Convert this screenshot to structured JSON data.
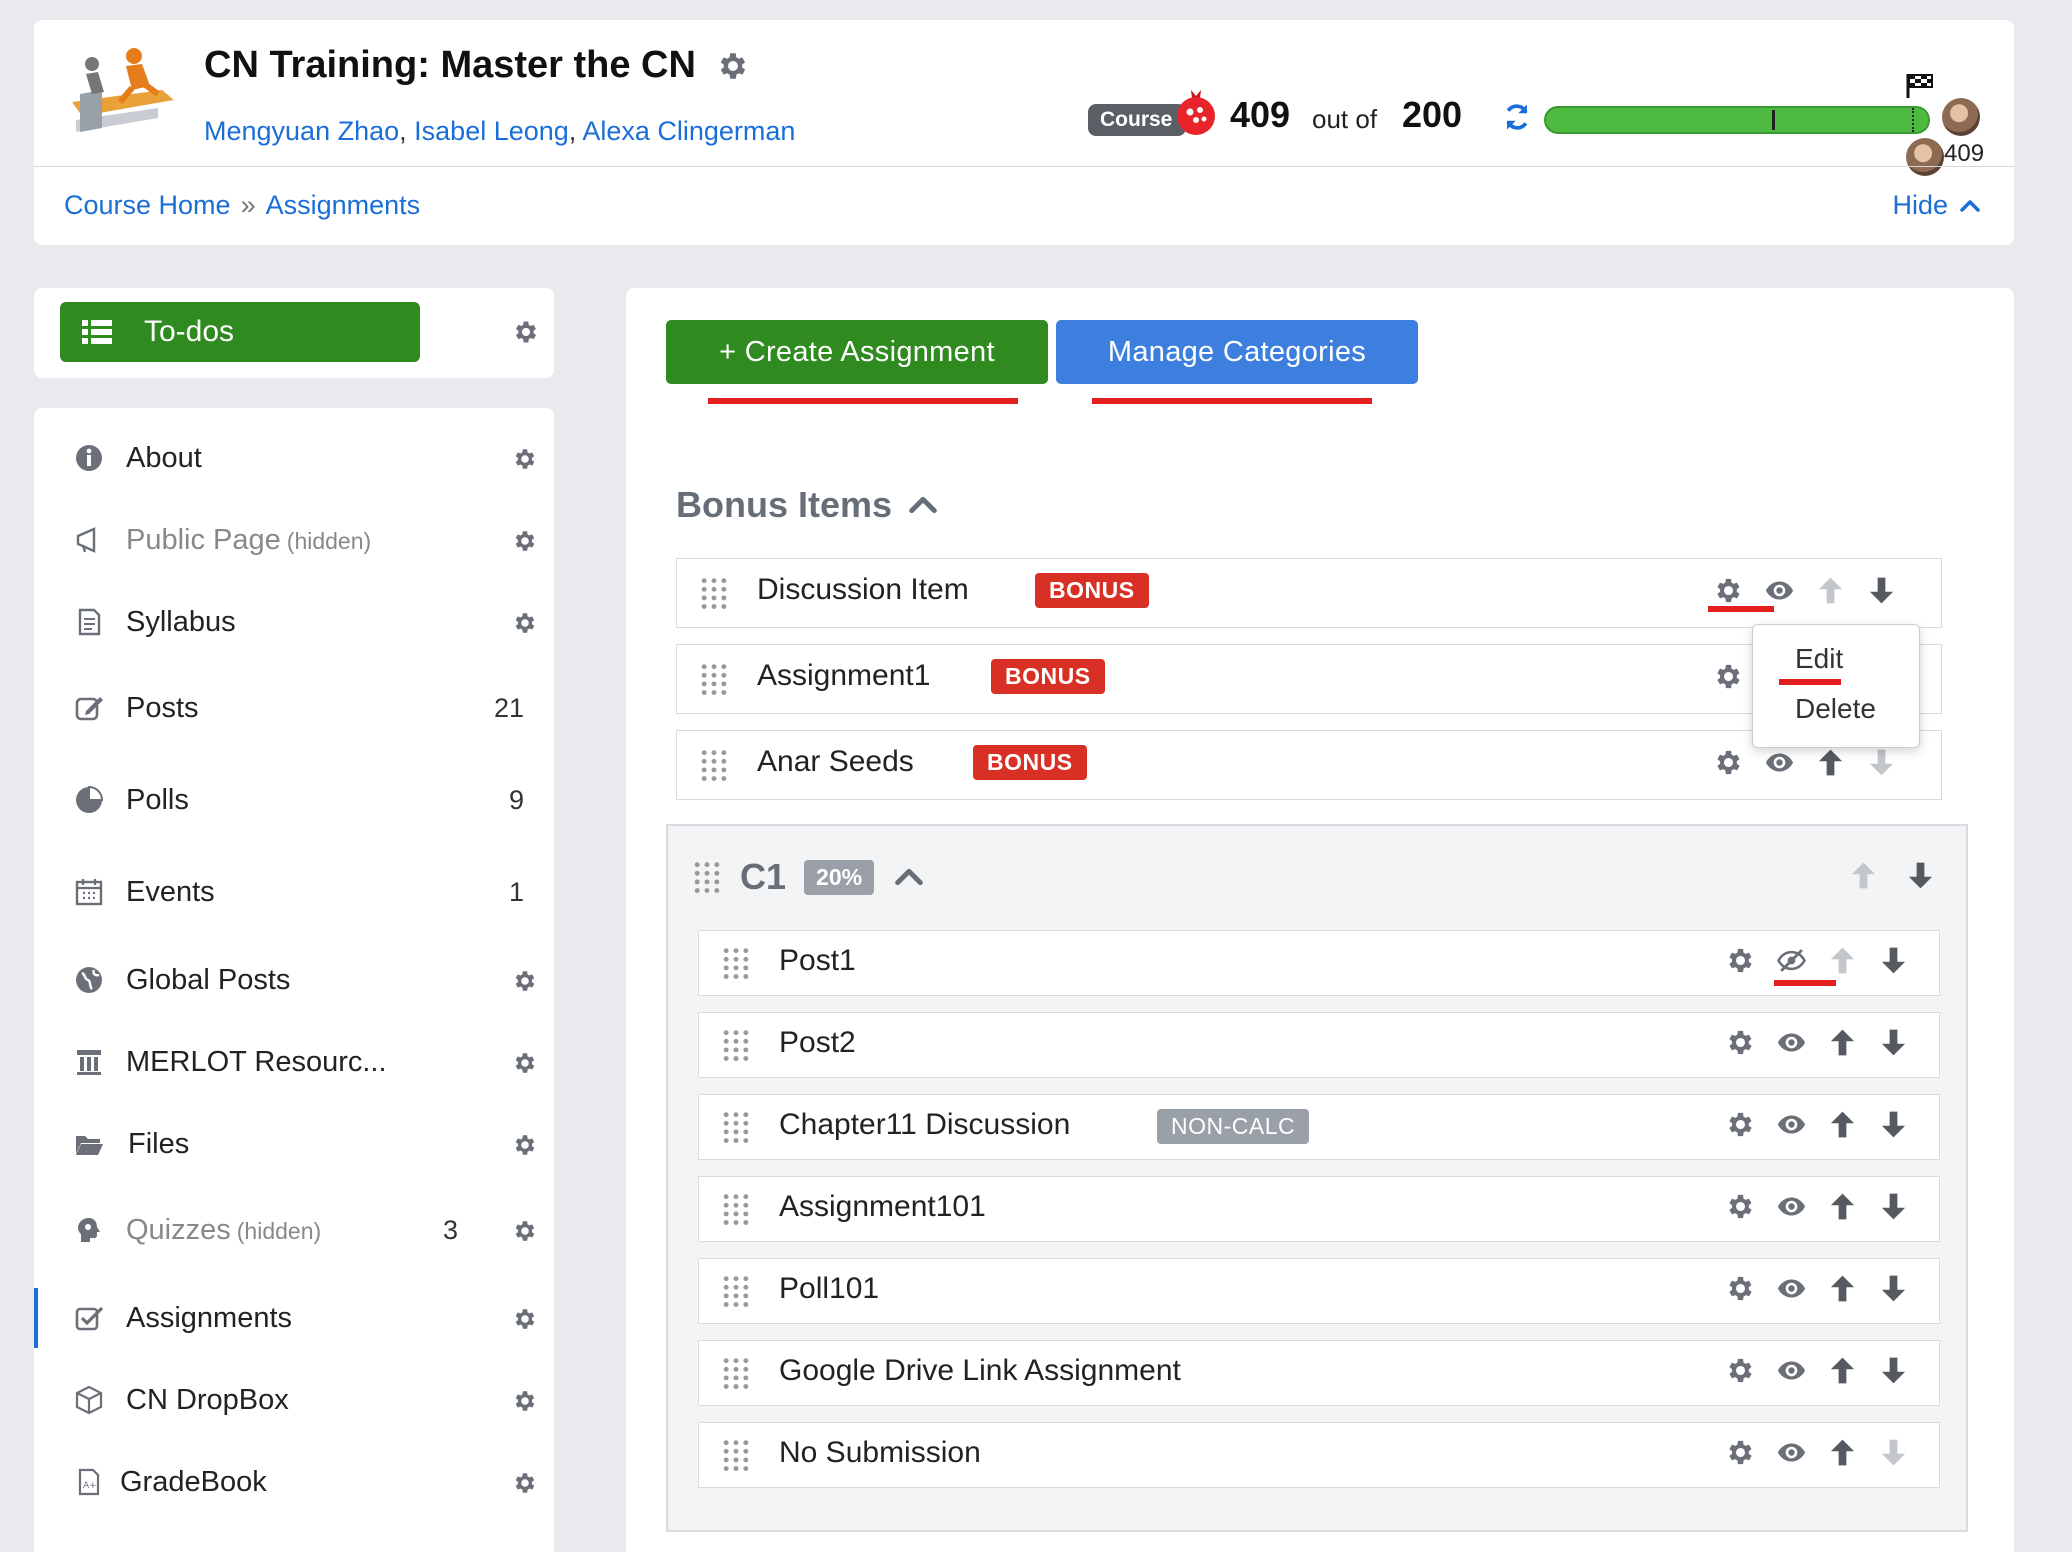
{
  "header": {
    "title": "CN Training: Master the CN",
    "instructors": [
      "Mengyuan Zhao",
      "Isabel Leong",
      "Alexa Clingerman"
    ],
    "course_badge": "Course",
    "score": "409",
    "score_of": "out of",
    "score_max": "200",
    "progress_fraction": 1.0,
    "leader_score": "409",
    "breadcrumb": [
      "Course Home",
      "Assignments"
    ],
    "hide_label": "Hide"
  },
  "todo": {
    "label": "To-dos"
  },
  "sidebar": {
    "items": [
      {
        "label": "About",
        "count": "",
        "hidden": "",
        "icon": "info-icon"
      },
      {
        "label": "Public Page",
        "count": "",
        "hidden": "(hidden)",
        "icon": "megaphone-icon"
      },
      {
        "label": "Syllabus",
        "count": "",
        "hidden": "",
        "icon": "document-icon"
      },
      {
        "label": "Posts",
        "count": "21",
        "hidden": "",
        "icon": "edit-icon"
      },
      {
        "label": "Polls",
        "count": "9",
        "hidden": "",
        "icon": "pie-icon"
      },
      {
        "label": "Events",
        "count": "1",
        "hidden": "",
        "icon": "calendar-icon"
      },
      {
        "label": "Global Posts",
        "count": "",
        "hidden": "",
        "icon": "globe-icon"
      },
      {
        "label": "MERLOT Resourc...",
        "count": "",
        "hidden": "",
        "icon": "pillar-icon"
      },
      {
        "label": "Files",
        "count": "",
        "hidden": "",
        "icon": "folder-icon"
      },
      {
        "label": "Quizzes",
        "count": "3",
        "hidden": "(hidden)",
        "icon": "brain-icon"
      },
      {
        "label": "Assignments",
        "count": "",
        "hidden": "",
        "icon": "check-square-icon"
      },
      {
        "label": "CN DropBox",
        "count": "",
        "hidden": "",
        "icon": "box-icon"
      },
      {
        "label": "GradeBook",
        "count": "",
        "hidden": "",
        "icon": "grade-icon"
      }
    ]
  },
  "main": {
    "create_label": "+ Create Assignment",
    "manage_label": "Manage Categories",
    "bonus_section": {
      "title": "Bonus Items",
      "items": [
        {
          "label": "Discussion Item",
          "badge": "BONUS"
        },
        {
          "label": "Assignment1",
          "badge": "BONUS"
        },
        {
          "label": "Anar Seeds",
          "badge": "BONUS"
        }
      ]
    },
    "dropdown": {
      "edit": "Edit",
      "delete": "Delete"
    },
    "category": {
      "title": "C1",
      "percent": "20%",
      "items": [
        {
          "label": "Post1",
          "badge": ""
        },
        {
          "label": "Post2",
          "badge": ""
        },
        {
          "label": "Chapter11 Discussion",
          "badge": "NON-CALC"
        },
        {
          "label": "Assignment101",
          "badge": ""
        },
        {
          "label": "Poll101",
          "badge": ""
        },
        {
          "label": "Google Drive Link Assignment",
          "badge": ""
        },
        {
          "label": "No Submission",
          "badge": ""
        }
      ]
    }
  },
  "colors": {
    "green": "#2f8a1f",
    "blue": "#3d7fde",
    "bonus_red": "#d93025",
    "annotation_red": "#e41f1f",
    "link": "#1a6ed8"
  }
}
